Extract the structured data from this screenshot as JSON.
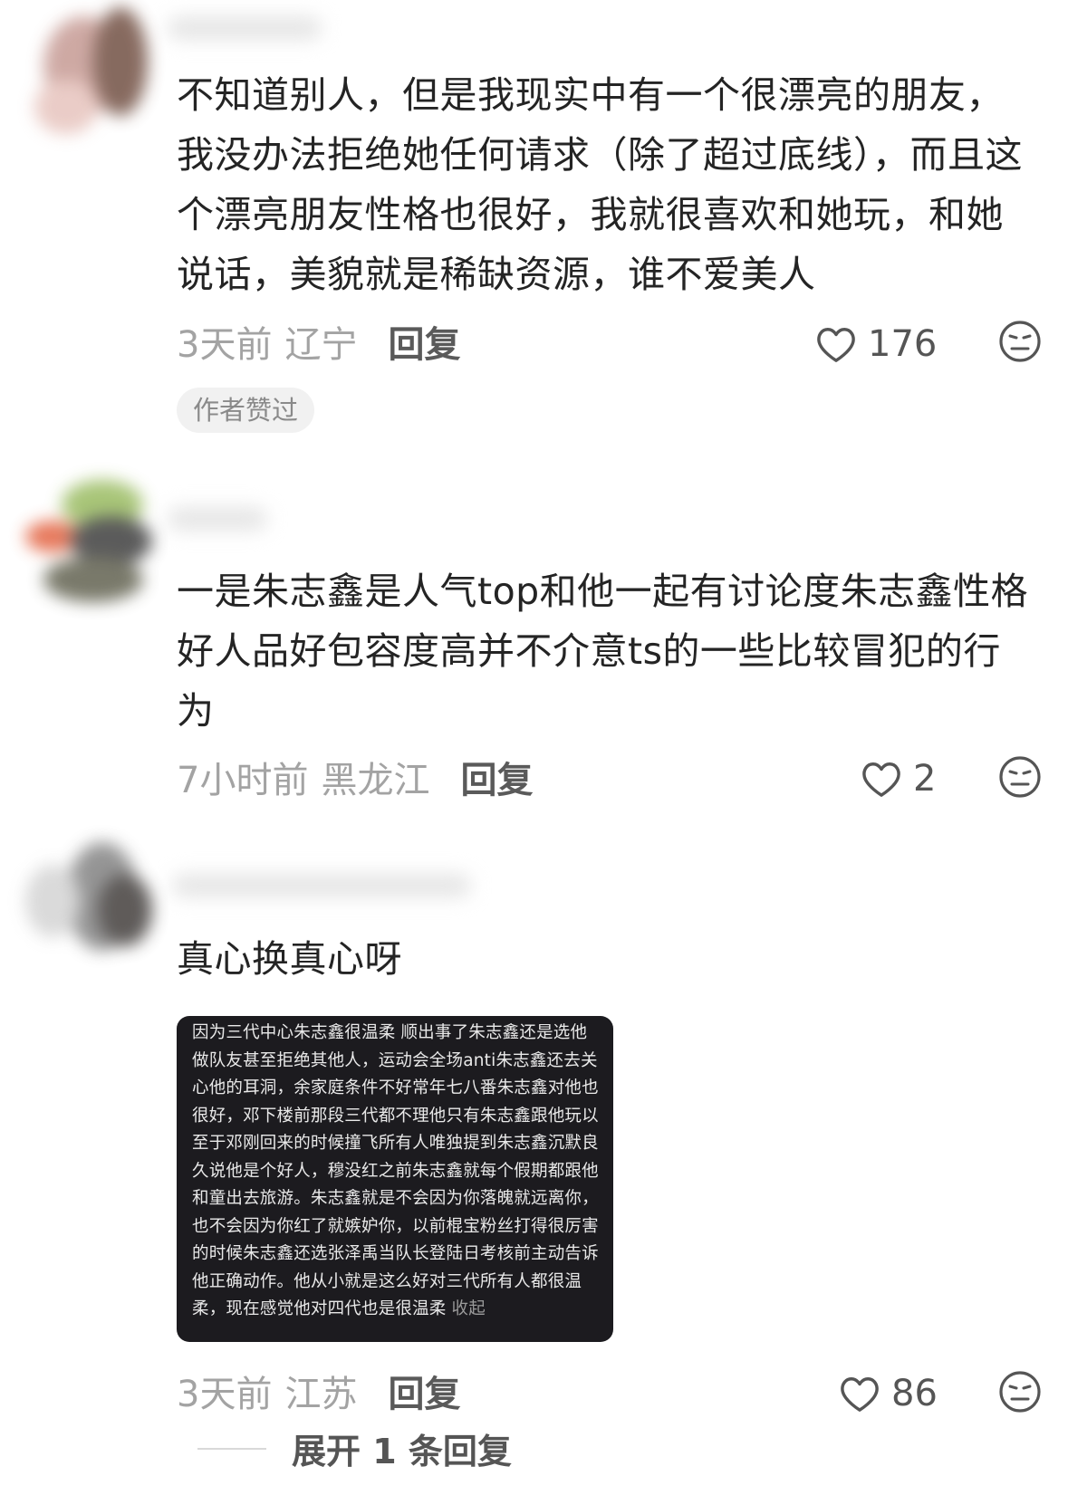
{
  "comments": [
    {
      "text": "不知道别人，但是我现实中有一个很漂亮的朋友，我没办法拒绝她任何请求（除了超过底线），而且这个漂亮朋友性格也很好，我就很喜欢和她玩，和她说话，美貌就是稀缺资源，谁不爱美人",
      "time": "3天前",
      "location": "辽宁",
      "reply_label": "回复",
      "likes": "176",
      "badge": "作者赞过"
    },
    {
      "text": "一是朱志鑫是人气top和他一起有讨论度朱志鑫性格好人品好包容度高并不介意ts的一些比较冒犯的行为",
      "time": "7小时前",
      "location": "黑龙江",
      "reply_label": "回复",
      "likes": "2"
    },
    {
      "text": "真心换真心呀",
      "image_text": "因为三代中心朱志鑫很温柔 顺出事了朱志鑫还是选他做队友甚至拒绝其他人，运动会全场anti朱志鑫还去关心他的耳洞，余家庭条件不好常年七八番朱志鑫对他也很好，邓下楼前那段三代都不理他只有朱志鑫跟他玩以至于邓刚回来的时候撞飞所有人唯独提到朱志鑫沉默良久说他是个好人，穆没红之前朱志鑫就每个假期都跟他和童出去旅游。朱志鑫就是不会因为你落魄就远离你，也不会因为你红了就嫉妒你，以前棍宝粉丝打得很厉害的时候朱志鑫还选张泽禹当队长登陆日考核前主动告诉他正确动作。他从小就是这么好对三代所有人都很温柔，现在感觉他对四代也是很温柔",
      "image_collapse": "收起",
      "time": "3天前",
      "location": "江苏",
      "reply_label": "回复",
      "likes": "86",
      "expand_label": "展开 1 条回复"
    }
  ],
  "icons": {
    "like": "heart-outline-icon",
    "reaction": "neutral-face-icon"
  },
  "colors": {
    "text": "#242424",
    "meta": "#a3a3a3",
    "badge_bg": "#f1f1f1",
    "image_bg": "#1c1b1f"
  }
}
